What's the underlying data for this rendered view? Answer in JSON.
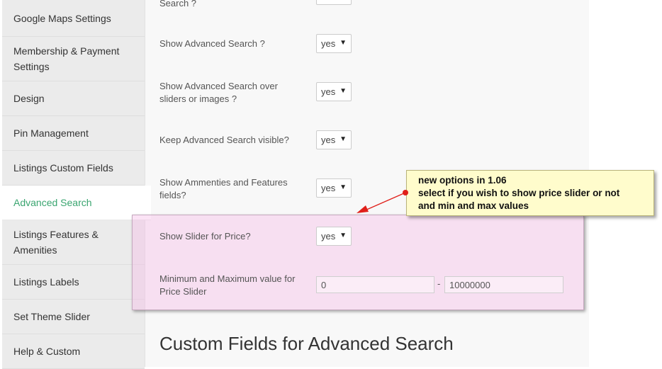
{
  "sidebar": {
    "items": [
      {
        "label": "Google Maps Settings"
      },
      {
        "label": "Membership & Payment Settings"
      },
      {
        "label": "Design"
      },
      {
        "label": "Pin Management"
      },
      {
        "label": "Listings Custom Fields"
      },
      {
        "label": "Advanced Search",
        "active": true
      },
      {
        "label": "Listings Features & Amenities"
      },
      {
        "label": "Listings Labels"
      },
      {
        "label": "Set Theme Slider"
      },
      {
        "label": "Help & Custom"
      }
    ]
  },
  "settings": {
    "partial_label": "Search ?",
    "rows": [
      {
        "label": "Show Advanced Search ?",
        "value": "yes"
      },
      {
        "label": "Show Advanced Search over sliders or images ?",
        "value": "yes"
      },
      {
        "label": "Keep Advanced Search visible?",
        "value": "yes"
      },
      {
        "label": "Show Ammenties and Features fields?",
        "value": "yes"
      },
      {
        "label": "Show Slider for Price?",
        "value": "yes"
      }
    ],
    "price_range": {
      "label": "Minimum and Maximum value for Price Slider",
      "min": "0",
      "separator": "-",
      "max": "10000000"
    }
  },
  "heading": "Custom Fields for Advanced Search",
  "callout": {
    "line1": "new options in 1.06",
    "line2": "select if you wish to show price slider or not",
    "line3": "and min and max values"
  },
  "colors": {
    "active_item": "#3aa570",
    "highlight": "#f5bce8",
    "callout_bg": "#fffccc",
    "arrow": "#e0201a"
  }
}
